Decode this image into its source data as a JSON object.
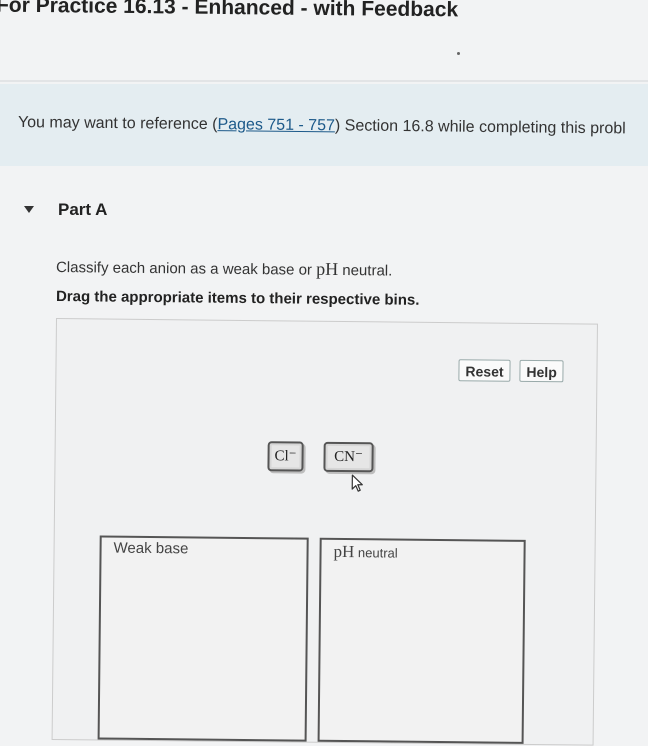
{
  "header": {
    "title": "For Practice 16.13 - Enhanced - with Feedback"
  },
  "reference": {
    "prefix": "You may want to reference (",
    "link": "Pages 751 - 757",
    "suffix": ") Section 16.8 while completing this probl"
  },
  "part": {
    "title": "Part A",
    "instruction_pre": "Classify each anion as a weak base or ",
    "instruction_ph": "pH",
    "instruction_post": " neutral.",
    "instruction_bold": "Drag the appropriate items to their respective bins."
  },
  "buttons": {
    "reset": "Reset",
    "help": "Help"
  },
  "items": [
    "Cl⁻",
    "CN⁻"
  ],
  "bins": {
    "weak_base": "Weak base",
    "neutral_ph": "pH",
    "neutral_word": " neutral"
  },
  "icons": {
    "caret": "triangle-down-icon",
    "cursor": "mouse-pointer-icon"
  },
  "colors": {
    "link": "#1d5a8a",
    "reference_band": "#e4edf1"
  }
}
